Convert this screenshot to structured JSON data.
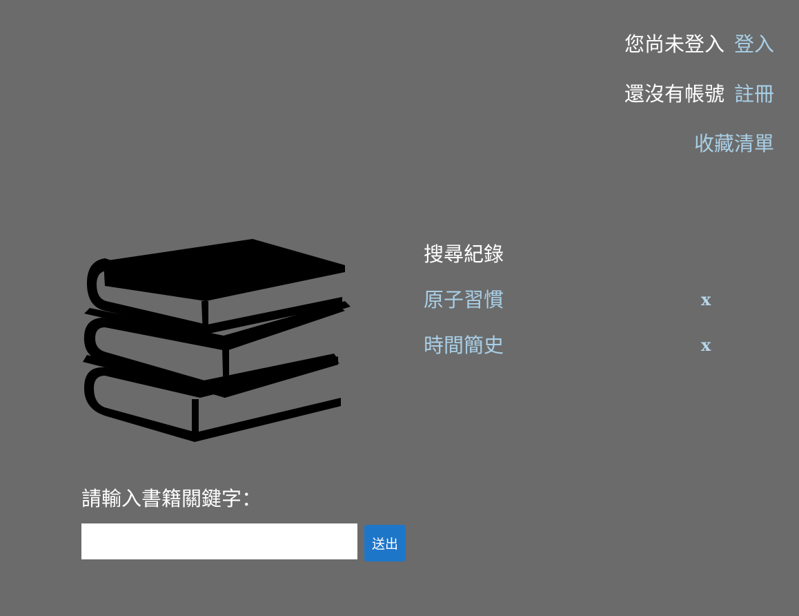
{
  "header": {
    "not_logged_in_text": "您尚未登入",
    "login_link": "登入",
    "no_account_text": "還沒有帳號",
    "register_link": "註冊",
    "favorites_link": "收藏清單"
  },
  "history": {
    "title": "搜尋紀錄",
    "items": [
      {
        "label": "原子習慣",
        "remove": "x"
      },
      {
        "label": "時間簡史",
        "remove": "x"
      }
    ]
  },
  "search": {
    "label": "請輸入書籍關鍵字：",
    "value": "",
    "placeholder": "",
    "submit_label": "送出"
  },
  "icons": {
    "hero": "books-stack-icon"
  },
  "colors": {
    "background": "#6b6b6b",
    "link": "#a9cfe6",
    "text": "#ffffff",
    "button": "#1e76c9"
  }
}
